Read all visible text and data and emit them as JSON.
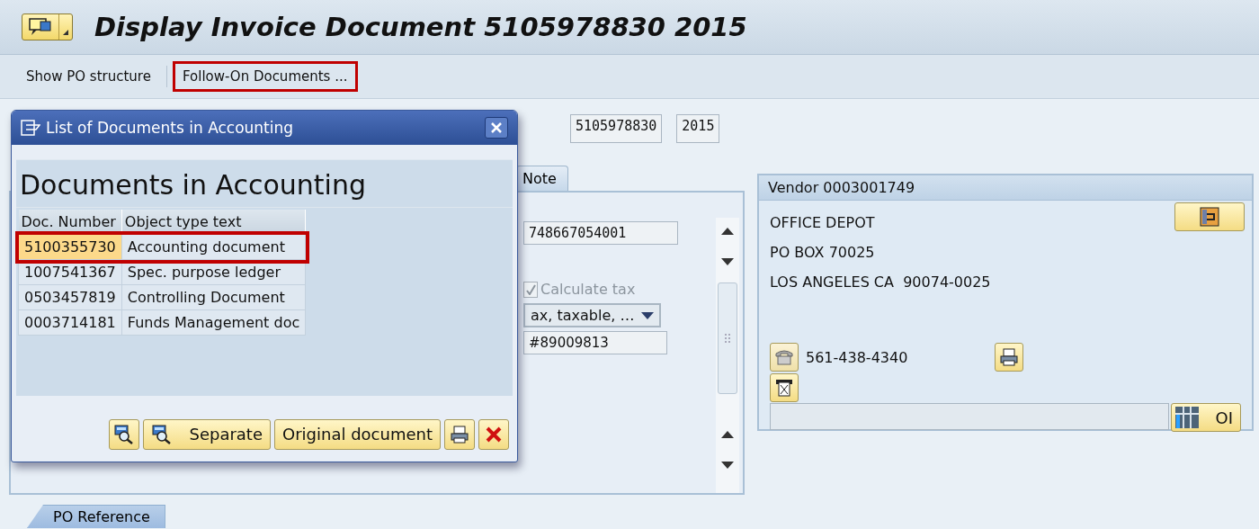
{
  "window": {
    "title": "Display Invoice Document 5105978830 2015"
  },
  "toolbar": [
    {
      "label": "Show PO structure",
      "highlighted": false
    },
    {
      "label": "Follow-On Documents ...",
      "highlighted": true
    }
  ],
  "header_fields": [
    "5105978830",
    "2015"
  ],
  "tabs": [
    {
      "label": "Note",
      "selected": false
    }
  ],
  "invoice_panel": {
    "reference": "748667054001",
    "calculate_tax": {
      "label": "Calculate tax",
      "checked": true,
      "disabled": true
    },
    "tax_code": "ax, taxable, …",
    "text_field": "#89009813"
  },
  "vendor": {
    "title": "Vendor 0003001749",
    "lines": [
      "OFFICE DEPOT",
      "PO BOX 70025",
      "LOS ANGELES CA  90074-0025"
    ],
    "phone": "561-438-4340",
    "oi_button": "OI"
  },
  "dialog": {
    "title": "List of Documents in Accounting",
    "heading": "Documents in Accounting",
    "columns": [
      "Doc. Number",
      "Object type text"
    ],
    "rows": [
      {
        "cells": [
          "5100355730",
          "Accounting document"
        ],
        "selected": true,
        "highlighted": true
      },
      {
        "cells": [
          "1007541367",
          "Spec. purpose ledger"
        ],
        "selected": false,
        "highlighted": false
      },
      {
        "cells": [
          "0503457819",
          "Controlling Document"
        ],
        "selected": false,
        "highlighted": false
      },
      {
        "cells": [
          "0003714181",
          "Funds Management doc"
        ],
        "selected": false,
        "highlighted": false
      }
    ],
    "buttons": [
      {
        "kind": "find"
      },
      {
        "kind": "find",
        "label": "Separate"
      },
      {
        "kind": "text",
        "label": "Original document"
      },
      {
        "kind": "print"
      },
      {
        "kind": "cancel"
      }
    ]
  },
  "bottom_tabs": [
    {
      "label": "PO Reference",
      "selected": true
    }
  ]
}
